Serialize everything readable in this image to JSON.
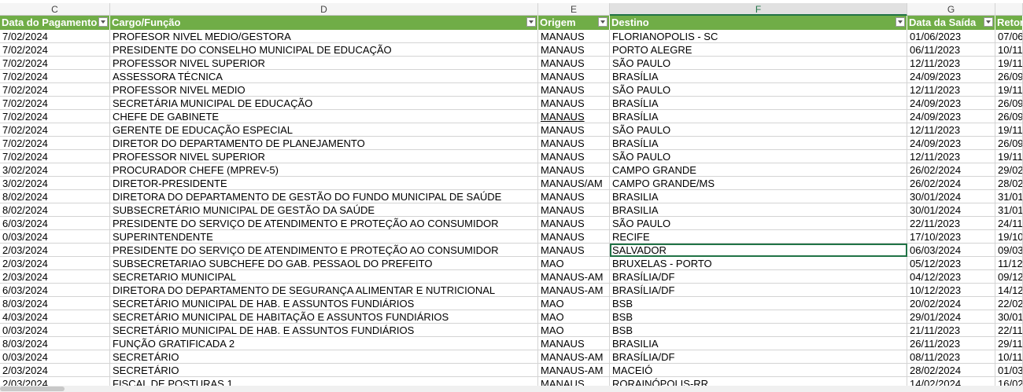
{
  "column_letters": [
    "C",
    "D",
    "E",
    "F",
    "G"
  ],
  "headers": [
    "Data do Pagamento",
    "Cargo/Função",
    "Origem",
    "Destino",
    "Data da Saída",
    "Retor"
  ],
  "rows": [
    [
      "7/02/2024",
      "PROFESOR NIVEL MEDIO/GESTORA",
      "MANAUS",
      "FLORIANOPOLIS - SC",
      "01/06/2023",
      "07/06"
    ],
    [
      "7/02/2024",
      "PRESIDENTE DO CONSELHO MUNICIPAL DE EDUCAÇÃO",
      "MANAUS",
      "PORTO ALEGRE",
      "06/11/2023",
      "10/11"
    ],
    [
      "7/02/2024",
      "PROFESSOR NIVEL SUPERIOR",
      "MANAUS",
      "SÃO PAULO",
      "12/11/2023",
      "19/11"
    ],
    [
      "7/02/2024",
      "ASSESSORA TÉCNICA",
      "MANAUS",
      "BRASÍLIA",
      "24/09/2023",
      "26/09"
    ],
    [
      "7/02/2024",
      "PROFESSOR NIVEL MEDIO",
      "MANAUS",
      "SÃO PAULO",
      "12/11/2023",
      "19/11"
    ],
    [
      "7/02/2024",
      "SECRETÁRIA MUNICIPAL DE EDUCAÇÃO",
      "MANAUS",
      "BRASÍLIA",
      "24/09/2023",
      "26/09"
    ],
    [
      "7/02/2024",
      "CHEFE DE GABINETE",
      "MANAUS",
      "BRASÍLIA",
      "24/09/2023",
      "26/09"
    ],
    [
      "7/02/2024",
      "GERENTE DE EDUCAÇÃO ESPECIAL",
      "MANAUS",
      "SÃO PAULO",
      "12/11/2023",
      "19/11"
    ],
    [
      "7/02/2024",
      "DIRETOR DO DEPARTAMENTO DE PLANEJAMENTO",
      "MANAUS",
      "BRASÍLIA",
      "24/09/2023",
      "26/09"
    ],
    [
      "7/02/2024",
      "PROFESSOR NIVEL SUPERIOR",
      "MANAUS",
      "SÃO PAULO",
      "12/11/2023",
      "19/11"
    ],
    [
      "3/02/2024",
      "PROCURADOR CHEFE (MPREV-5)",
      "MANAUS",
      "CAMPO GRANDE",
      "26/02/2024",
      "29/02"
    ],
    [
      "3/02/2024",
      "DIRETOR-PRESIDENTE",
      "MANAUS/AM",
      "CAMPO GRANDE/MS",
      "26/02/2024",
      "28/02"
    ],
    [
      "8/02/2024",
      "DIRETORA DO DEPARTAMENTO DE GESTÃO DO FUNDO MUNICIPAL DE SAÚDE",
      "MANAUS",
      "BRASILIA",
      "30/01/2024",
      "31/01"
    ],
    [
      "8/02/2024",
      "SUBSECRETÁRIO MUNICIPAL DE GESTÃO DA SAÚDE",
      "MANAUS",
      "BRASILIA",
      "30/01/2024",
      "31/01"
    ],
    [
      "6/03/2024",
      "PRESIDENTE DO SERVIÇO DE ATENDIMENTO E PROTEÇÃO AO CONSUMIDOR",
      "MANAUS",
      "SÃO PAULO",
      "22/11/2023",
      "24/11"
    ],
    [
      "0/03/2024",
      "SUPERINTENDENTE",
      "MANAUS",
      "RECIFE",
      "17/10/2023",
      "19/10"
    ],
    [
      "2/03/2024",
      "PRESIDENTE DO SERVIÇO DE ATENDIMENTO E PROTEÇÃO AO CONSUMIDOR",
      "MANAUS",
      "SALVADOR",
      "06/03/2024",
      "09/03"
    ],
    [
      "2/03/2024",
      "SUBSECRETARIAO SUBCHEFE DO GAB. PESSAOL DO PREFEITO",
      "MAO",
      "BRUXELAS - PORTO",
      "05/12/2023",
      "11/12"
    ],
    [
      "2/03/2024",
      "SECRETARIO MUNICIPAL",
      "MANAUS-AM",
      "BRASÍLIA/DF",
      "04/12/2023",
      "09/12"
    ],
    [
      "6/03/2024",
      "DIRETORA DO DEPARTAMENTO DE SEGURANÇA ALIMENTAR E NUTRICIONAL",
      "MANAUS-AM",
      "BRASÍLIA/DF",
      "10/12/2023",
      "14/12"
    ],
    [
      "8/03/2024",
      "SECRETÁRIO MUNICIPAL DE HAB. E ASSUNTOS FUNDIÁRIOS",
      "MAO",
      "BSB",
      "20/02/2024",
      "22/02"
    ],
    [
      "4/03/2024",
      "SECRETÁRIO MUNICIPAL DE HABITAÇÃO E ASSUNTOS FUNDIÁRIOS",
      "MAO",
      "BSB",
      "29/01/2024",
      "30/01"
    ],
    [
      "0/03/2024",
      "SECRETÁRIO MUNICIPAL DE HAB. E ASSUNTOS FUNDIÁRIOS",
      "MAO",
      "BSB",
      "21/11/2023",
      "22/11"
    ],
    [
      "8/03/2024",
      "FUNÇÃO GRATIFICADA 2",
      "MANAUS",
      "BRASILIA",
      "26/11/2023",
      "29/11"
    ],
    [
      "0/03/2024",
      "SECRETÁRIO",
      "MANAUS-AM",
      "BRASÍLIA/DF",
      "08/11/2023",
      "10/11"
    ],
    [
      "2/03/2024",
      "SECRETÁRIO",
      "MANAUS-AM",
      "MACEIÓ",
      "28/02/2024",
      "01/03"
    ],
    [
      "2/03/2024",
      "FISCAL DE POSTURAS 1",
      "MANAUS",
      "RORAINÓPOLIS-RR",
      "14/02/2024",
      "16/02"
    ]
  ],
  "selected_cell": {
    "row_index": 16,
    "column": "F"
  },
  "colors": {
    "header_bg": "#70ad47",
    "header_text": "#ffffff",
    "selection": "#217346",
    "grid": "#d4d4d4"
  }
}
